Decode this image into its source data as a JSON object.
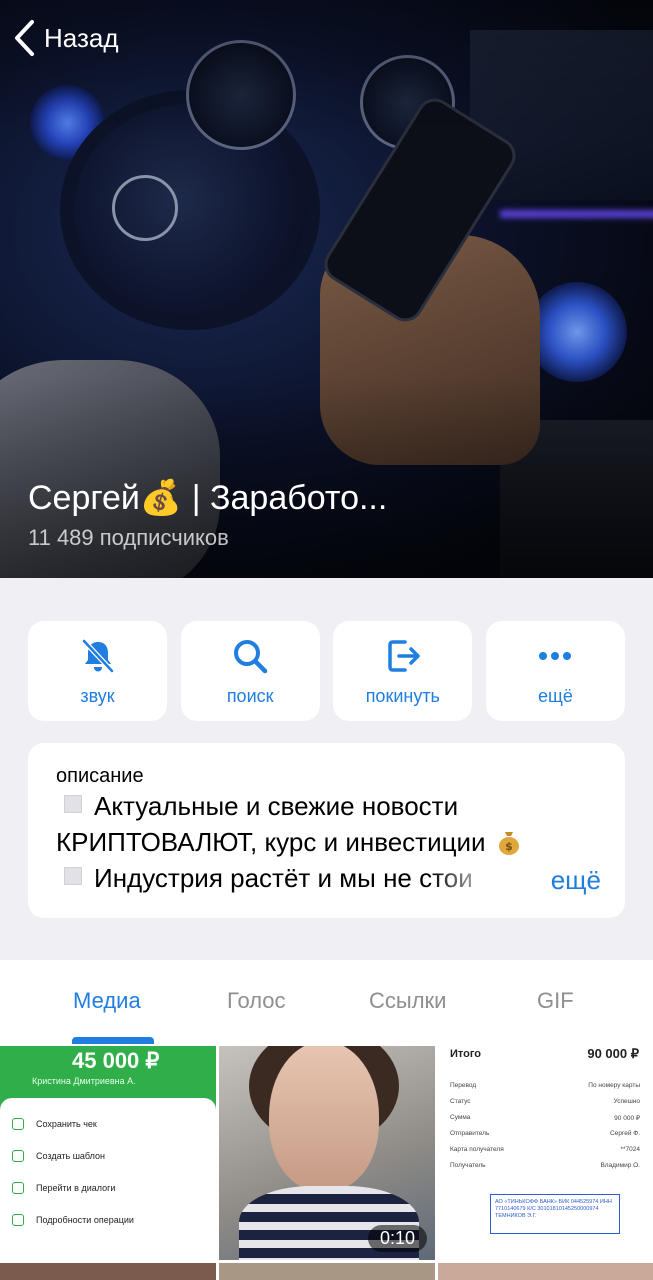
{
  "nav": {
    "back_label": "Назад"
  },
  "channel": {
    "title": "Сергей💰 | Заработо...",
    "subscribers": "11 489 подписчиков"
  },
  "actions": [
    {
      "label": "звук",
      "icon": "bell-muted-icon"
    },
    {
      "label": "поиск",
      "icon": "search-icon"
    },
    {
      "label": "покинуть",
      "icon": "leave-icon"
    },
    {
      "label": "ещё",
      "icon": "more-dots-icon"
    }
  ],
  "description": {
    "label": "описание",
    "line1": "Актуальные и свежие новости",
    "line2": "КРИПТОВАЛЮТ, курс и инвестиции",
    "line3": "Индустрия растёт и мы не стои",
    "more": "ещё"
  },
  "tabs": [
    {
      "label": "Медиа",
      "active": true
    },
    {
      "label": "Голос",
      "active": false
    },
    {
      "label": "Ссылки",
      "active": false
    },
    {
      "label": "GIF",
      "active": false
    }
  ],
  "media": {
    "receipt_green": {
      "amount": "45 000 ₽",
      "recipient": "Кристина Дмитриевна А.",
      "items": [
        "Сохранить чек",
        "Создать шаблон",
        "Перейти в диалоги",
        "Подробности операции"
      ]
    },
    "video": {
      "duration": "0:10"
    },
    "receipt_white": {
      "total_label": "Итого",
      "total_value": "90 000 ₽",
      "rows": [
        {
          "k": "Перевод",
          "v": "По номеру карты"
        },
        {
          "k": "Статус",
          "v": "Успешно"
        },
        {
          "k": "Сумма",
          "v": "90 000 ₽"
        },
        {
          "k": "Отправитель",
          "v": "Сергей Ф."
        },
        {
          "k": "Карта получателя",
          "v": "**7024"
        },
        {
          "k": "Получатель",
          "v": "Владимир О."
        }
      ],
      "stamp": "АО «ТИНЬКОФФ БАНК» БИК 044525974 ИНН 7710140679 К/С 30101810145250000974 ТЕМНИКОВ Э.Г."
    }
  },
  "colors": {
    "accent": "#1f7ee0",
    "background": "#efeff4",
    "receipt_green": "#2fae4a"
  }
}
